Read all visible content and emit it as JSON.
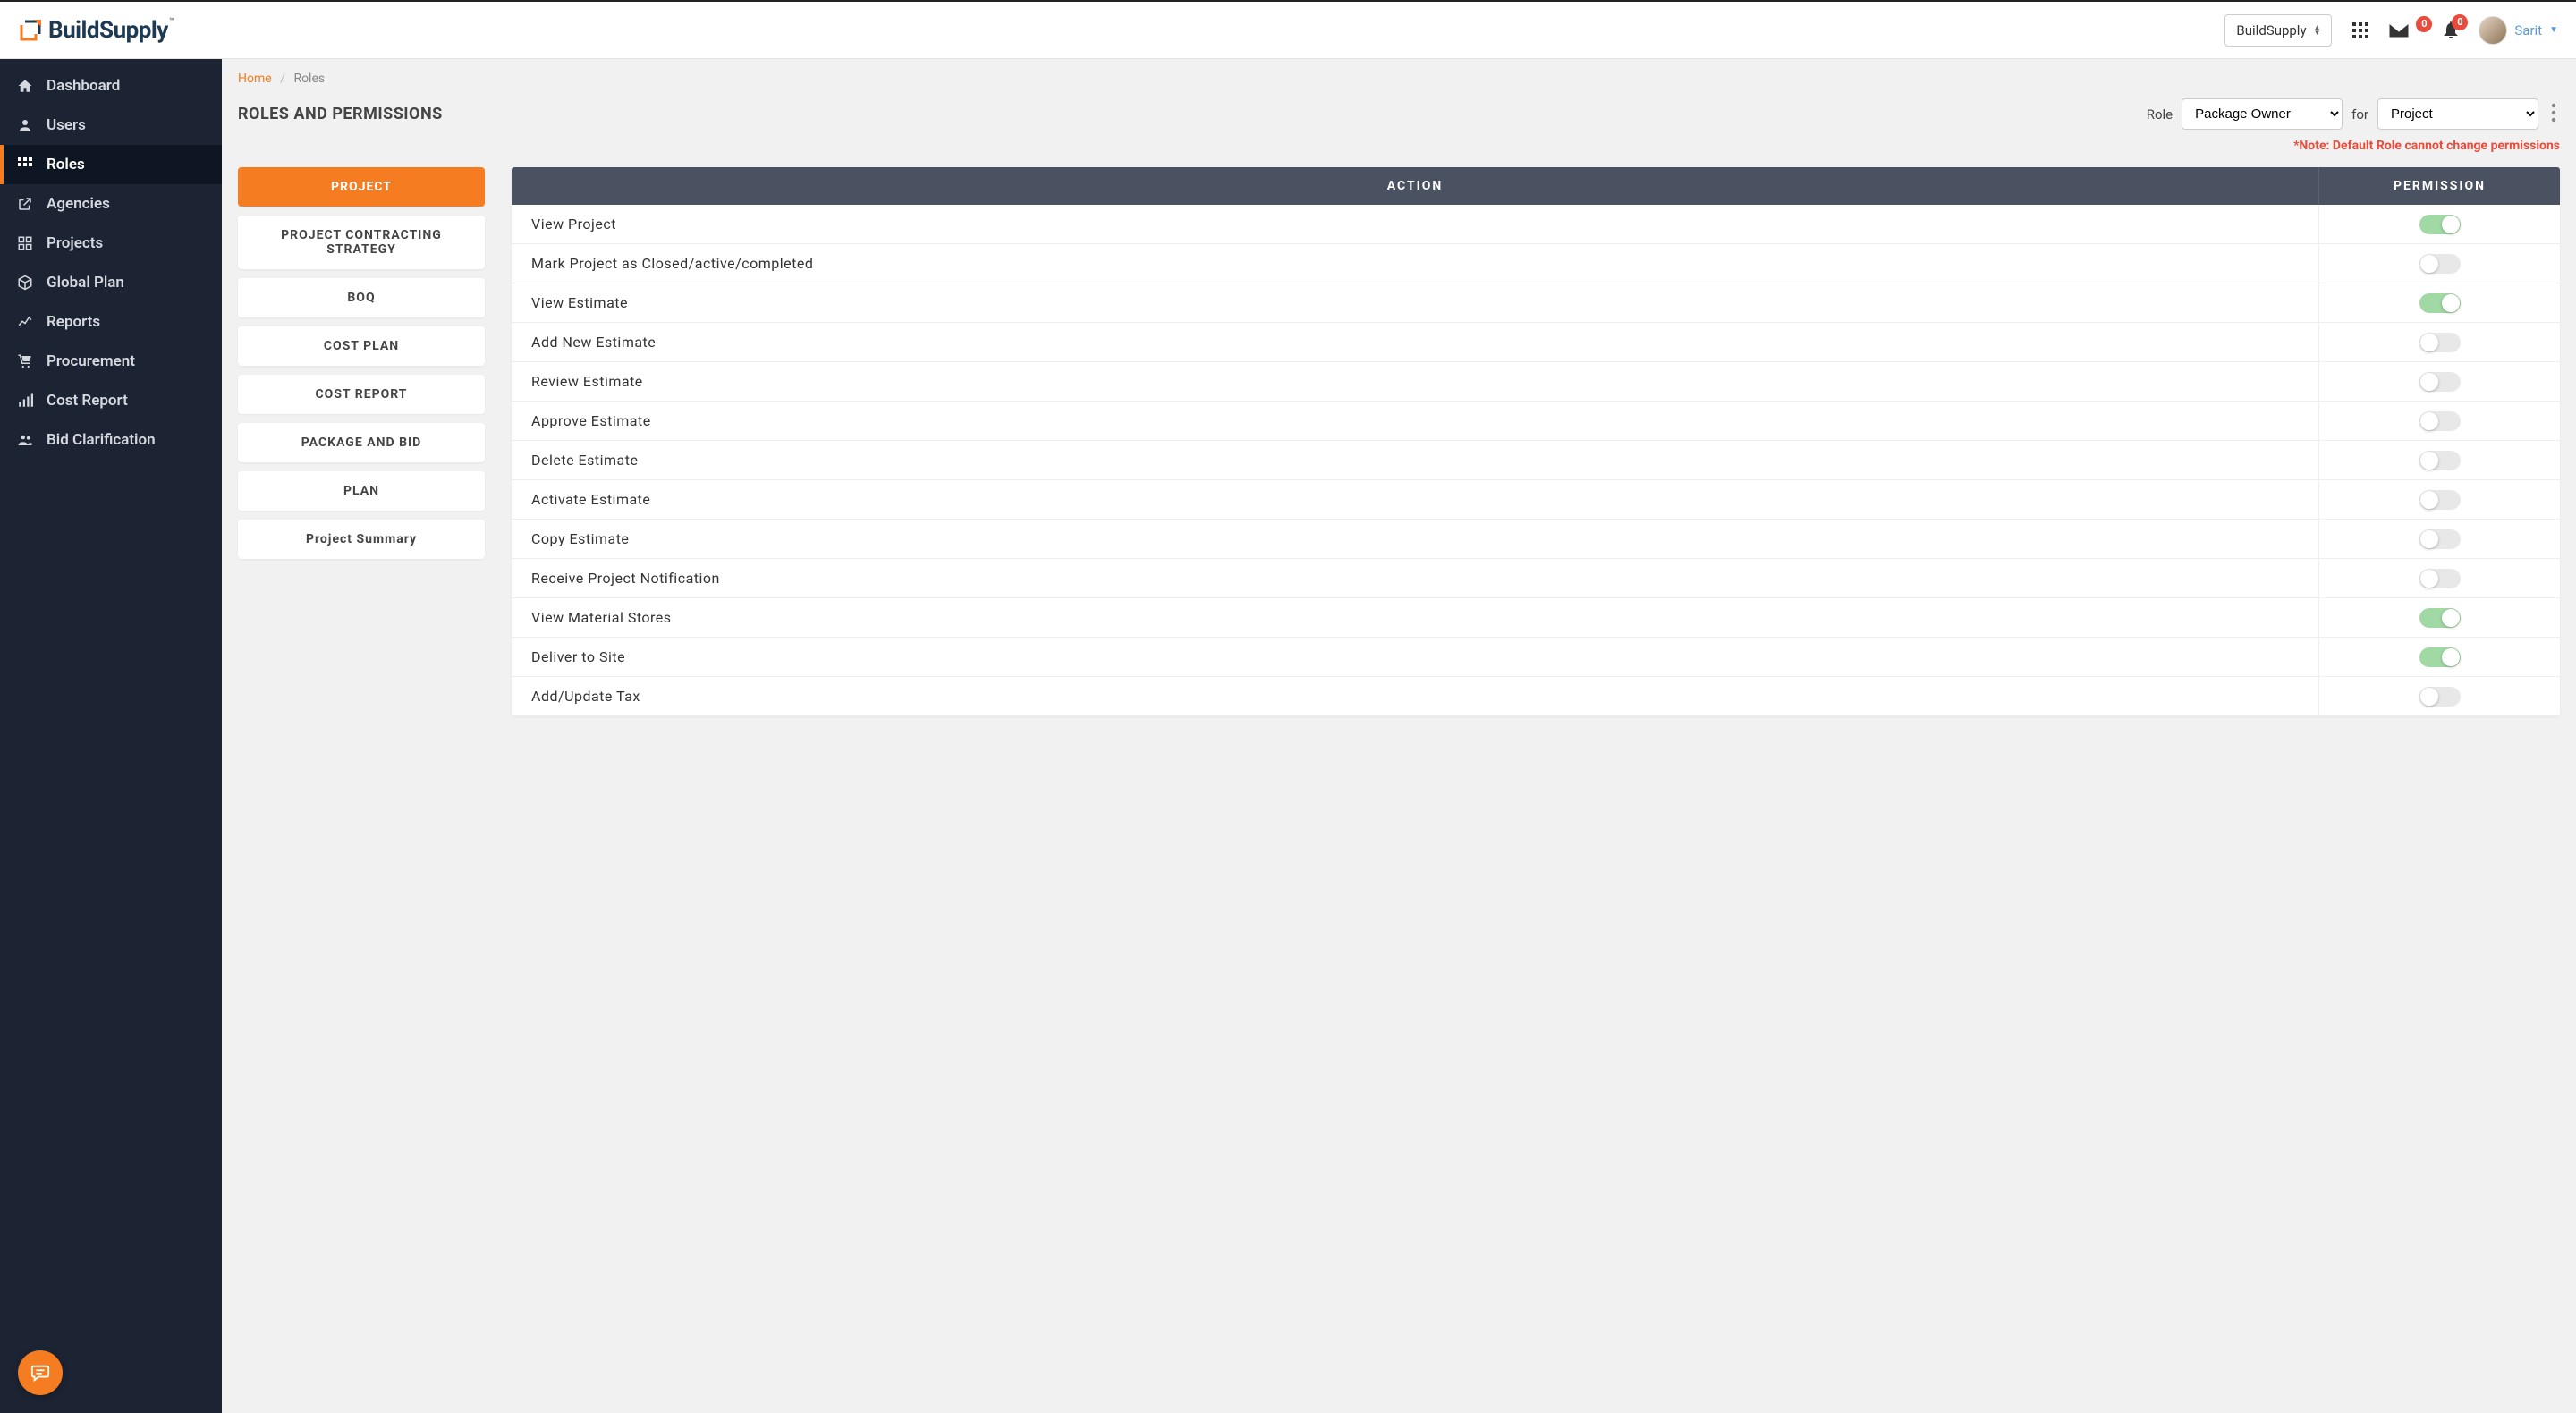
{
  "brand": {
    "name": "BuildSupply",
    "tm": "™"
  },
  "header": {
    "org": "BuildSupply",
    "mail_badge": "0",
    "bell_badge": "0",
    "user_name": "Sarit"
  },
  "sidebar": {
    "items": [
      {
        "label": "Dashboard",
        "icon": "home"
      },
      {
        "label": "Users",
        "icon": "user"
      },
      {
        "label": "Roles",
        "icon": "grid",
        "active": true
      },
      {
        "label": "Agencies",
        "icon": "external"
      },
      {
        "label": "Projects",
        "icon": "apps"
      },
      {
        "label": "Global Plan",
        "icon": "cube"
      },
      {
        "label": "Reports",
        "icon": "chart"
      },
      {
        "label": "Procurement",
        "icon": "cart"
      },
      {
        "label": "Cost Report",
        "icon": "bars"
      },
      {
        "label": "Bid Clarification",
        "icon": "persons"
      }
    ]
  },
  "breadcrumb": {
    "home": "Home",
    "current": "Roles"
  },
  "page": {
    "title": "ROLES AND PERMISSIONS",
    "role_label": "Role",
    "role_value": "Package Owner",
    "for_label": "for",
    "for_value": "Project",
    "note": "*Note: Default Role cannot change permissions"
  },
  "categories": [
    {
      "label": "PROJECT",
      "active": true
    },
    {
      "label": "PROJECT CONTRACTING STRATEGY"
    },
    {
      "label": "BOQ"
    },
    {
      "label": "COST PLAN"
    },
    {
      "label": "COST REPORT"
    },
    {
      "label": "PACKAGE AND BID"
    },
    {
      "label": "PLAN"
    },
    {
      "label": "Project Summary"
    }
  ],
  "table": {
    "action_header": "ACTION",
    "permission_header": "PERMISSION",
    "rows": [
      {
        "action": "View Project",
        "on": true
      },
      {
        "action": "Mark Project as Closed/active/completed",
        "on": false
      },
      {
        "action": "View Estimate",
        "on": true
      },
      {
        "action": "Add New Estimate",
        "on": false
      },
      {
        "action": "Review Estimate",
        "on": false
      },
      {
        "action": "Approve Estimate",
        "on": false
      },
      {
        "action": "Delete Estimate",
        "on": false
      },
      {
        "action": "Activate Estimate",
        "on": false
      },
      {
        "action": "Copy Estimate",
        "on": false
      },
      {
        "action": "Receive Project Notification",
        "on": false
      },
      {
        "action": "View Material Stores",
        "on": true
      },
      {
        "action": "Deliver to Site",
        "on": true
      },
      {
        "action": "Add/Update Tax",
        "on": false
      }
    ]
  }
}
